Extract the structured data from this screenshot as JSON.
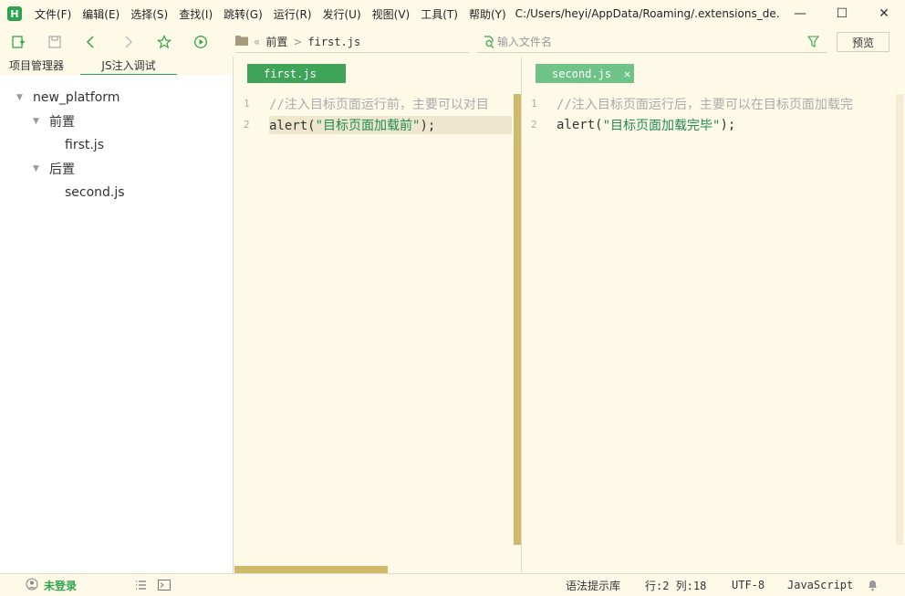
{
  "app": {
    "logo_letter": "H",
    "title_path": "C:/Users/heyi/AppData/Roaming/.extensions_de..."
  },
  "menu": [
    "文件(F)",
    "编辑(E)",
    "选择(S)",
    "查找(I)",
    "跳转(G)",
    "运行(R)",
    "发行(U)",
    "视图(V)",
    "工具(T)",
    "帮助(Y)"
  ],
  "window_controls": {
    "minimize": "—",
    "maximize": "☐",
    "close": "✕"
  },
  "toolbar": {
    "icons": [
      "new-file-icon",
      "save-icon",
      "back-icon",
      "forward-icon",
      "favorite-star-icon",
      "run-icon"
    ],
    "breadcrumb": {
      "collapse": "«",
      "folder": "前置",
      "sep": ">",
      "file": "first.js"
    },
    "search_placeholder": "输入文件名",
    "preview_label": "预览"
  },
  "sidebar": {
    "tabs": [
      "项目管理器",
      "JS注入调试"
    ],
    "active_tab": 1,
    "tree": {
      "root": "new_platform",
      "folder1": "前置",
      "file1": "first.js",
      "folder2": "后置",
      "file2": "second.js"
    }
  },
  "editor_left": {
    "tab": "first.js",
    "lines": [
      {
        "n": "1",
        "comment": "//注入目标页面运行前，主要可以对目"
      },
      {
        "n": "2",
        "fn": "alert(",
        "str": "\"目标页面加载前\"",
        "end": ");"
      }
    ]
  },
  "editor_right": {
    "tab": "second.js",
    "close": "✕",
    "lines": [
      {
        "n": "1",
        "comment": "//注入目标页面运行后，主要可以在目标页面加载完"
      },
      {
        "n": "2",
        "fn": "alert(",
        "str": "\"目标页面加载完毕\"",
        "end": ");"
      }
    ]
  },
  "status": {
    "login": "未登录",
    "syntax": "语法提示库",
    "position": "行:2  列:18",
    "encoding": "UTF-8",
    "language": "JavaScript"
  },
  "colors": {
    "accent": "#2ea44f",
    "background": "#fffae8",
    "scrollbar": "#cfb96b",
    "string": "#1d8b53"
  }
}
